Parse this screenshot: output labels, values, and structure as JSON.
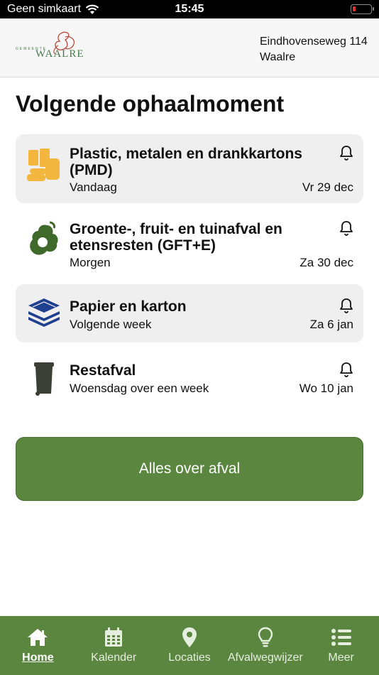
{
  "status_bar": {
    "carrier": "Geen simkaart",
    "time": "15:45"
  },
  "header": {
    "logo_text": "WAALRE",
    "logo_small": "GEMEENTE",
    "address_line1": "Eindhovenseweg 114",
    "address_line2": "Waalre"
  },
  "page": {
    "title": "Volgende ophaalmoment"
  },
  "collections": [
    {
      "title": "Plastic, metalen en drankkartons (PMD)",
      "when": "Vandaag",
      "date": "Vr 29 dec",
      "icon": "pmd-icon"
    },
    {
      "title": "Groente-, fruit- en tuinafval en etensresten (GFT+E)",
      "when": "Morgen",
      "date": "Za 30 dec",
      "icon": "gft-icon"
    },
    {
      "title": "Papier en karton",
      "when": "Volgende week",
      "date": "Za 6 jan",
      "icon": "paper-icon"
    },
    {
      "title": "Restafval",
      "when": "Woensdag over een week",
      "date": "Wo 10 jan",
      "icon": "bin-icon"
    }
  ],
  "actions": {
    "all_about_waste": "Alles over afval"
  },
  "tabs": [
    {
      "label": "Home",
      "icon": "home-icon",
      "active": true
    },
    {
      "label": "Kalender",
      "icon": "calendar-icon",
      "active": false
    },
    {
      "label": "Locaties",
      "icon": "location-pin-icon",
      "active": false
    },
    {
      "label": "Afvalwegwijzer",
      "icon": "lightbulb-icon",
      "active": false
    },
    {
      "label": "Meer",
      "icon": "list-icon",
      "active": false
    }
  ],
  "colors": {
    "brand_green": "#5a8640",
    "pmd_yellow": "#f3b73f",
    "gft_green": "#3f6a2c",
    "paper_blue": "#1f3f8f",
    "bin_gray": "#3b3f36"
  }
}
